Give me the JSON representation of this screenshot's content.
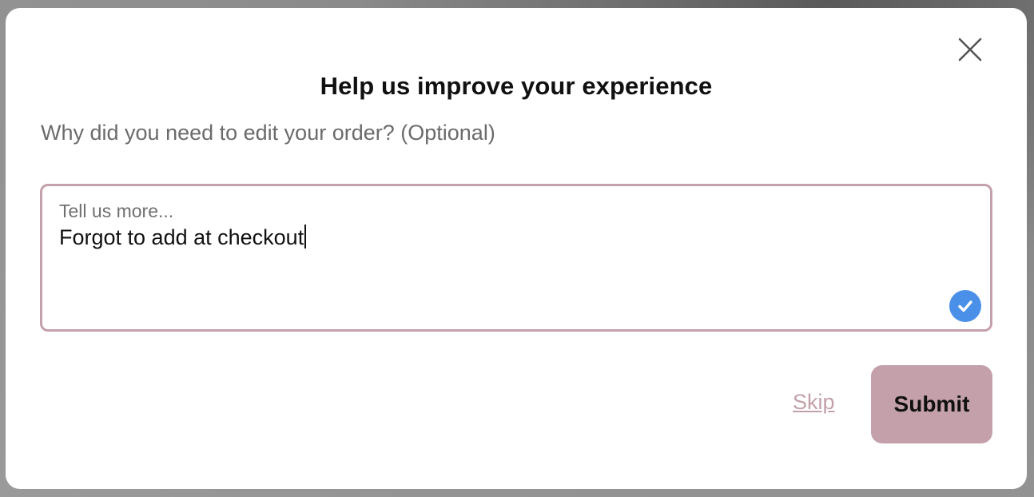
{
  "dialog": {
    "title": "Help us improve your experience",
    "question": "Why did you need to edit your order? (Optional)",
    "textarea": {
      "placeholder": "Tell us more...",
      "value": "Forgot to add at checkout"
    },
    "actions": {
      "skip_label": "Skip",
      "submit_label": "Submit"
    }
  },
  "icons": {
    "close": "close-icon",
    "check": "checkmark-icon"
  },
  "colors": {
    "accent": "#c4a1aa",
    "check_badge": "#4a90e8",
    "title_text": "#111111",
    "muted_text": "#6b6b6b"
  }
}
